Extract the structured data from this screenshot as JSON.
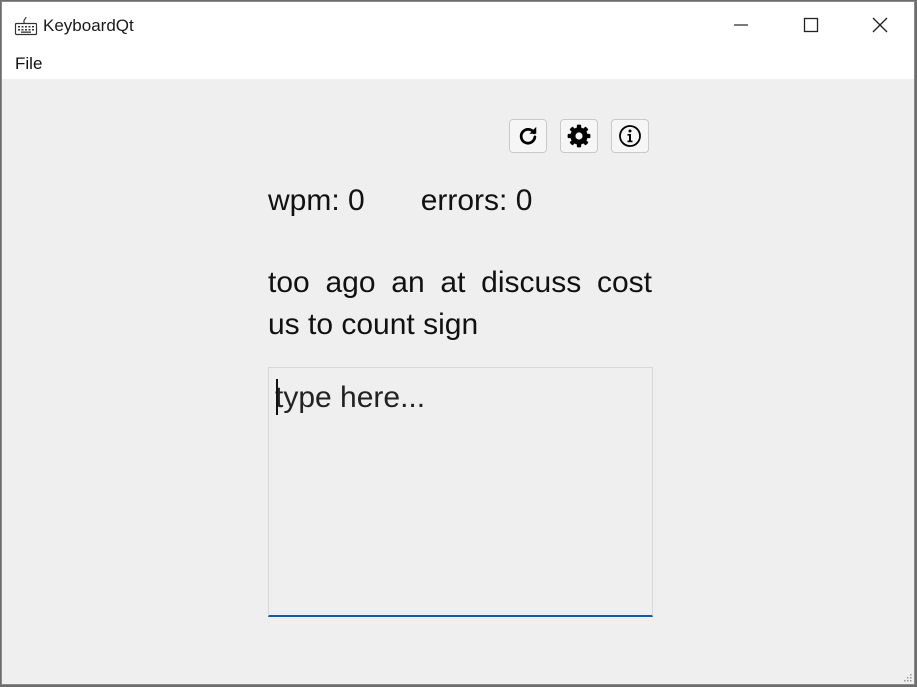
{
  "window": {
    "title": "KeyboardQt",
    "icon": "keyboard-icon",
    "controls": [
      "minimize-icon",
      "maximize-icon",
      "close-icon"
    ]
  },
  "menu": {
    "items": [
      {
        "label": "File"
      }
    ]
  },
  "toolbar": {
    "buttons": [
      {
        "name": "restart-button",
        "icon": "refresh-icon"
      },
      {
        "name": "settings-button",
        "icon": "gear-icon"
      },
      {
        "name": "info-button",
        "icon": "info-icon"
      }
    ]
  },
  "stats": {
    "wpm_label": "wpm: 0",
    "errors_label": "errors: 0"
  },
  "prompt": {
    "text": "too ago an at discuss cost us to count sign"
  },
  "input": {
    "value": "",
    "placeholder": "type here..."
  },
  "colors": {
    "window_bg": "#efefef",
    "titlebar_bg": "#ffffff",
    "input_focus_underline": "#0a5ea8"
  }
}
